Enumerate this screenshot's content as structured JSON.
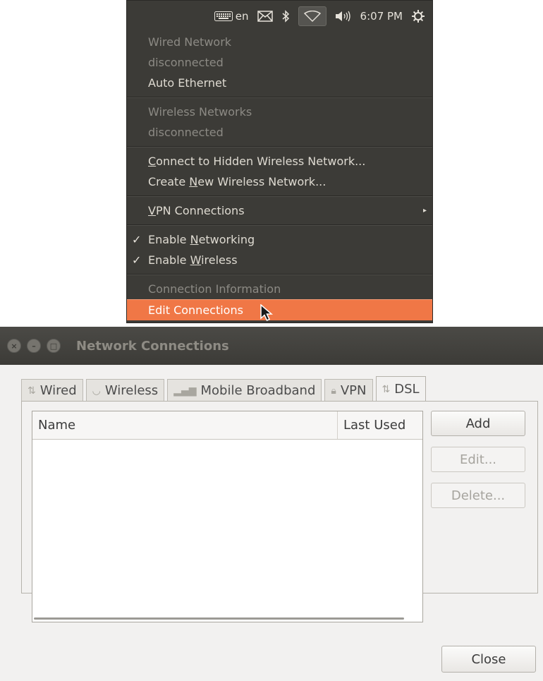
{
  "panel": {
    "keyboard_icon": "keyboard-icon",
    "language": "en",
    "mail_icon": "envelope-icon",
    "bluetooth_icon": "bluetooth-icon",
    "network_icon": "wifi-icon",
    "volume_icon": "volume-icon",
    "time": "6:07 PM",
    "session_icon": "power-gear-icon"
  },
  "menu": {
    "wired_header": "Wired Network",
    "wired_status": "disconnected",
    "auto_ethernet": "Auto Ethernet",
    "wireless_header": "Wireless Networks",
    "wireless_status": "disconnected",
    "hidden_pre": "C",
    "hidden_rest": "onnect to Hidden Wireless Network...",
    "new_pre": "Create ",
    "new_u": "N",
    "new_rest": "ew Wireless Network...",
    "vpn_u": "V",
    "vpn_rest": "PN Connections",
    "enable_net_pre": "Enable ",
    "enable_net_u": "N",
    "enable_net_rest": "etworking",
    "enable_wl_pre": "Enable ",
    "enable_wl_u": "W",
    "enable_wl_rest": "ireless",
    "connection_info": "Connection Information",
    "edit_connections": "Edit Connections",
    "check": "✓",
    "arrow": "▸"
  },
  "window": {
    "title": "Network Connections",
    "tabs": [
      {
        "label": "Wired",
        "icon": "arrows-icon"
      },
      {
        "label": "Wireless",
        "icon": "wifi-icon"
      },
      {
        "label": "Mobile Broadband",
        "icon": "signal-icon"
      },
      {
        "label": "VPN",
        "icon": "lock-icon"
      },
      {
        "label": "DSL",
        "icon": "arrows-icon"
      }
    ],
    "columns": {
      "name": "Name",
      "last_used": "Last Used"
    },
    "buttons": {
      "add": "Add",
      "edit": "Edit...",
      "delete": "Delete...",
      "close": "Close"
    }
  },
  "colors": {
    "menu_bg": "#3c3b37",
    "highlight": "#f07746"
  }
}
